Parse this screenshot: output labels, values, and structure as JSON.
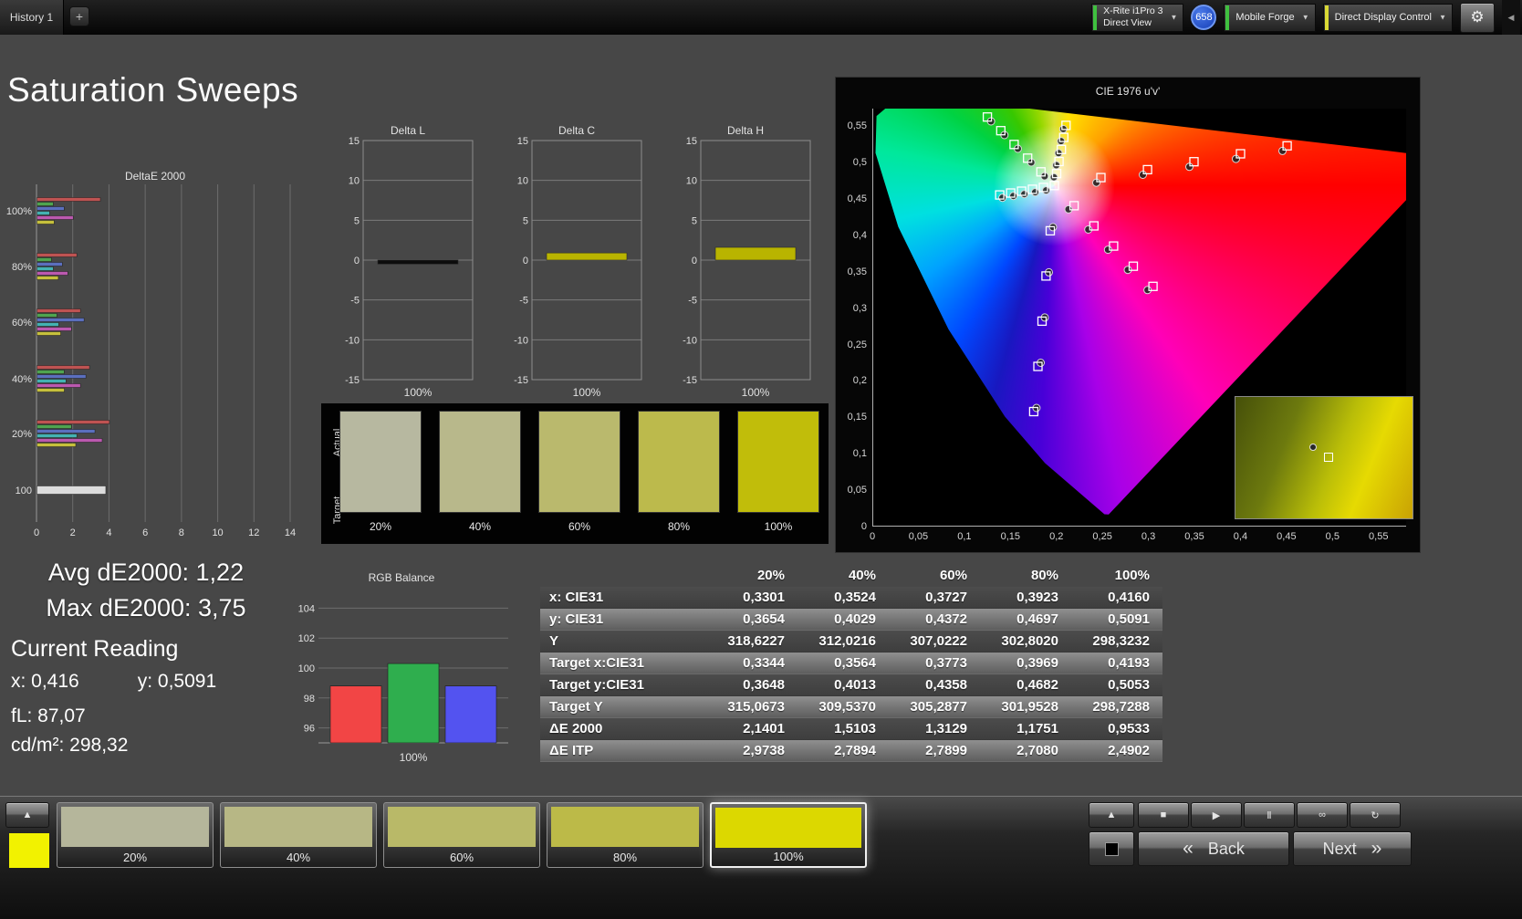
{
  "topbar": {
    "history_tab": "History 1",
    "add_tab_label": "+",
    "meter_dropdown": {
      "line1": "X-Rite i1Pro 3",
      "line2": "Direct View"
    },
    "badge_count": "658",
    "source_dropdown": "Mobile Forge",
    "control_dropdown": "Direct Display Control"
  },
  "page_title": "Saturation Sweeps",
  "summary": {
    "avg": "Avg dE2000: 1,22",
    "max": "Max dE2000: 3,75",
    "current_reading_title": "Current Reading",
    "x_reading": "x: 0,416",
    "y_reading": "y: 0,5091",
    "fl_reading": "fL: 87,07",
    "cd_reading": "cd/m²: 298,32"
  },
  "patch_strip": {
    "actual_label": "Actual",
    "target_label": "Target",
    "labels": [
      "20%",
      "40%",
      "60%",
      "80%",
      "100%"
    ],
    "colors": [
      "#b7b8a0",
      "#b8b88b",
      "#bab96d",
      "#bcba4c",
      "#c1bd0a"
    ]
  },
  "table": {
    "columns": [
      "20%",
      "40%",
      "60%",
      "80%",
      "100%"
    ],
    "rows": [
      {
        "label": "x: CIE31",
        "values": [
          "0,3301",
          "0,3524",
          "0,3727",
          "0,3923",
          "0,4160"
        ]
      },
      {
        "label": "y: CIE31",
        "values": [
          "0,3654",
          "0,4029",
          "0,4372",
          "0,4697",
          "0,5091"
        ]
      },
      {
        "label": "Y",
        "values": [
          "318,6227",
          "312,0216",
          "307,0222",
          "302,8020",
          "298,3232"
        ]
      },
      {
        "label": "Target x:CIE31",
        "values": [
          "0,3344",
          "0,3564",
          "0,3773",
          "0,3969",
          "0,4193"
        ]
      },
      {
        "label": "Target y:CIE31",
        "values": [
          "0,3648",
          "0,4013",
          "0,4358",
          "0,4682",
          "0,5053"
        ]
      },
      {
        "label": "Target Y",
        "values": [
          "315,0673",
          "309,5370",
          "305,2877",
          "301,9528",
          "298,7288"
        ]
      },
      {
        "label": "ΔE 2000",
        "values": [
          "2,1401",
          "1,5103",
          "1,3129",
          "1,1751",
          "0,9533"
        ]
      },
      {
        "label": "ΔE ITP",
        "values": [
          "2,9738",
          "2,7894",
          "2,7899",
          "2,7080",
          "2,4902"
        ]
      }
    ]
  },
  "bottombar": {
    "current_patch_color": "#f2f200",
    "swatches": [
      {
        "label": "20%",
        "color": "#b5b69b",
        "selected": false
      },
      {
        "label": "40%",
        "color": "#b7b785",
        "selected": false
      },
      {
        "label": "60%",
        "color": "#b9b968",
        "selected": false
      },
      {
        "label": "80%",
        "color": "#bcba48",
        "selected": false
      },
      {
        "label": "100%",
        "color": "#dcd800",
        "selected": true
      }
    ],
    "back_label": "Back",
    "next_label": "Next"
  },
  "chart_data": [
    {
      "id": "deltae2000",
      "type": "bar",
      "orientation": "horizontal",
      "title": "DeltaE 2000",
      "xlim": [
        0,
        14
      ],
      "xticks": [
        0,
        2,
        4,
        6,
        8,
        10,
        12,
        14
      ],
      "series": [
        "red",
        "green",
        "blue",
        "cyan",
        "magenta",
        "yellow"
      ],
      "series_colors": [
        "#bf5352",
        "#4fa44f",
        "#5b6fbe",
        "#43b2b2",
        "#bb59af",
        "#c6c03c"
      ],
      "groups": [
        {
          "label": "100%",
          "values": [
            3.5,
            0.9,
            1.5,
            0.7,
            2.0,
            0.95
          ]
        },
        {
          "label": "80%",
          "values": [
            2.2,
            0.8,
            1.4,
            0.9,
            1.7,
            1.18
          ]
        },
        {
          "label": "60%",
          "values": [
            2.4,
            1.1,
            2.6,
            1.2,
            1.9,
            1.31
          ]
        },
        {
          "label": "40%",
          "values": [
            2.9,
            1.5,
            2.7,
            1.6,
            2.4,
            1.51
          ]
        },
        {
          "label": "20%",
          "values": [
            4.0,
            1.9,
            3.2,
            2.2,
            3.6,
            2.14
          ]
        },
        {
          "label": "100",
          "values": [
            3.8
          ],
          "wide": true,
          "colors": [
            "#dcdcdc"
          ]
        }
      ]
    },
    {
      "id": "delta_l",
      "type": "bar",
      "title": "Delta L",
      "ylim": [
        -15,
        15
      ],
      "yticks": [
        15,
        10,
        5,
        0,
        -5,
        -10,
        -15
      ],
      "xlabel": "100%",
      "values": [
        -0.5
      ],
      "bar_color": "#0c0c0c"
    },
    {
      "id": "delta_c",
      "type": "bar",
      "title": "Delta C",
      "ylim": [
        -15,
        15
      ],
      "yticks": [
        15,
        10,
        5,
        0,
        -5,
        -10,
        -15
      ],
      "xlabel": "100%",
      "values": [
        0.9
      ],
      "bar_color": "#b9b400"
    },
    {
      "id": "delta_h",
      "type": "bar",
      "title": "Delta H",
      "ylim": [
        -15,
        15
      ],
      "yticks": [
        15,
        10,
        5,
        0,
        -5,
        -10,
        -15
      ],
      "xlabel": "100%",
      "values": [
        1.6
      ],
      "bar_color": "#b9b400"
    },
    {
      "id": "rgb_balance",
      "type": "bar",
      "title": "RGB Balance",
      "ylim": [
        95,
        105
      ],
      "yticks": [
        104,
        102,
        100,
        98,
        96
      ],
      "xlabel": "100%",
      "categories": [
        "R",
        "G",
        "B"
      ],
      "values": [
        98.8,
        100.3,
        98.8
      ],
      "colors": [
        "#f24545",
        "#2fae4e",
        "#5353f0"
      ]
    },
    {
      "id": "cie1976",
      "type": "scatter",
      "title": "CIE 1976 u'v'",
      "xlim": [
        0,
        0.58
      ],
      "ylim": [
        0,
        0.574
      ],
      "tick_step": 0.05,
      "tick_labels": [
        "0",
        "0,05",
        "0,1",
        "0,15",
        "0,2",
        "0,25",
        "0,3",
        "0,35",
        "0,4",
        "0,45",
        "0,5",
        "0,55"
      ],
      "white_point": [
        0.1978,
        0.4683
      ],
      "locus": [
        [
          0.6234,
          0.5065
        ],
        [
          0.52,
          0.522
        ],
        [
          0.4035,
          0.5393
        ],
        [
          0.2623,
          0.5604
        ],
        [
          0.1531,
          0.5766
        ],
        [
          0.0792,
          0.5856
        ],
        [
          0.0231,
          0.5836
        ],
        [
          0.0046,
          0.5638
        ],
        [
          0.0035,
          0.5131
        ],
        [
          0.0282,
          0.4117
        ],
        [
          0.0828,
          0.2708
        ],
        [
          0.1441,
          0.151
        ],
        [
          0.1877,
          0.0871
        ],
        [
          0.2522,
          0.0169
        ],
        [
          0.2568,
          0.0165
        ]
      ],
      "targets": [
        [
          0.1978,
          0.4683
        ],
        [
          0.2484,
          0.4792
        ],
        [
          0.299,
          0.4901
        ],
        [
          0.3495,
          0.5011
        ],
        [
          0.4001,
          0.512
        ],
        [
          0.4507,
          0.5229
        ],
        [
          0.1832,
          0.4871
        ],
        [
          0.1687,
          0.506
        ],
        [
          0.1541,
          0.5248
        ],
        [
          0.1396,
          0.5437
        ],
        [
          0.125,
          0.5625
        ],
        [
          0.1933,
          0.4062
        ],
        [
          0.1888,
          0.3441
        ],
        [
          0.1844,
          0.2821
        ],
        [
          0.1799,
          0.22
        ],
        [
          0.1754,
          0.1579
        ],
        [
          0.1859,
          0.4657
        ],
        [
          0.174,
          0.4632
        ],
        [
          0.1622,
          0.4606
        ],
        [
          0.1503,
          0.4581
        ],
        [
          0.1384,
          0.4555
        ],
        [
          0.2192,
          0.4406
        ],
        [
          0.2407,
          0.4129
        ],
        [
          0.2621,
          0.3852
        ],
        [
          0.2836,
          0.3575
        ],
        [
          0.305,
          0.3298
        ],
        [
          0.2003,
          0.4848
        ],
        [
          0.2029,
          0.5013
        ],
        [
          0.2054,
          0.5179
        ],
        [
          0.208,
          0.5344
        ],
        [
          0.2105,
          0.5509
        ]
      ],
      "measured": [
        [
          0.2434,
          0.4722
        ],
        [
          0.294,
          0.4831
        ],
        [
          0.3445,
          0.4941
        ],
        [
          0.3951,
          0.505
        ],
        [
          0.4457,
          0.5159
        ],
        [
          0.1872,
          0.4811
        ],
        [
          0.1727,
          0.5
        ],
        [
          0.1581,
          0.5188
        ],
        [
          0.1436,
          0.5377
        ],
        [
          0.129,
          0.5565
        ],
        [
          0.1963,
          0.4112
        ],
        [
          0.1918,
          0.3491
        ],
        [
          0.1874,
          0.2871
        ],
        [
          0.1829,
          0.225
        ],
        [
          0.1784,
          0.1629
        ],
        [
          0.1889,
          0.4617
        ],
        [
          0.177,
          0.4592
        ],
        [
          0.1652,
          0.4566
        ],
        [
          0.1533,
          0.4541
        ],
        [
          0.1414,
          0.4515
        ],
        [
          0.2132,
          0.4356
        ],
        [
          0.2347,
          0.4079
        ],
        [
          0.2561,
          0.3802
        ],
        [
          0.2776,
          0.3525
        ],
        [
          0.299,
          0.3248
        ],
        [
          0.1973,
          0.4798
        ],
        [
          0.1999,
          0.4963
        ],
        [
          0.2024,
          0.5129
        ],
        [
          0.205,
          0.5294
        ],
        [
          0.2075,
          0.5459
        ]
      ]
    }
  ]
}
